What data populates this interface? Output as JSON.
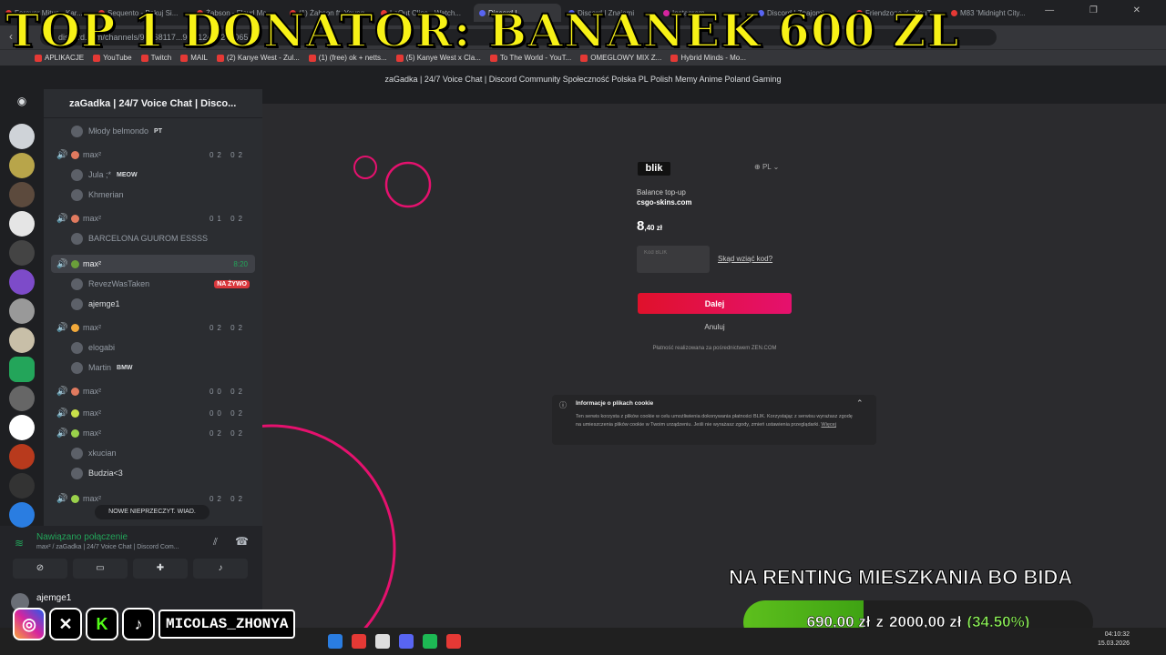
{
  "overlay": {
    "donator_banner": "TOP 1 DONATOR: BANANEK 600 ZL",
    "headline": "NA RENTING MIESZKANIA BO BIDA",
    "goal": {
      "current": "690,00 zł",
      "sep": "z",
      "target": "2000,00 zł",
      "percent": "(34.50%)",
      "fraction": 0.345
    },
    "handle": "MICOLAS_ZHONYA",
    "social_icons": [
      "instagram-icon",
      "x-icon",
      "kick-icon",
      "tiktok-icon"
    ]
  },
  "browser": {
    "tabs": [
      "Forever Mitus - Kar...",
      "Sequento - Pakuj Si...",
      "Żabson - Floyd Ma...",
      "(1) Żabson ft. Young...",
      "LeOut Clips - Watch...",
      "Discord |",
      "Discord | Znajomi",
      "Instagram",
      "Discord | Znajomi",
      "Friendzone :( - YouT...",
      "M83 'Midnight City..."
    ],
    "url": "discord.com/channels/96068117...96/112428245065...",
    "bookmarks": [
      "APLIKACJE",
      "YouTube",
      "Twitch",
      "MAIL",
      "(2) Kanye West - Zul...",
      "(1) (free) ok + netts...",
      "(5) Kanye West x Cla...",
      "To The World - YouT...",
      "OMEGLOWY MIX Z...",
      "Hybrid Minds - Mo..."
    ],
    "window_title": "zaGadka | 24/7 Voice Chat | Discord Community Społeczność Polska PL Polish Memy Anime Poland Gaming"
  },
  "discord": {
    "server_name": "zaGadka | 24/7 Voice Chat | Disco...",
    "channels": [
      {
        "type": "member",
        "name": "Młody belmondo",
        "tag": "PT"
      },
      {
        "type": "vc",
        "name": "max²",
        "count": "02 02"
      },
      {
        "type": "member",
        "name": "Jula ;*",
        "tag": "MEOW"
      },
      {
        "type": "member",
        "name": "Khmerian"
      },
      {
        "type": "vc",
        "name": "max²",
        "count": "01 02"
      },
      {
        "type": "member",
        "name": "BARCELONA GUUROM ESSSS"
      },
      {
        "type": "vc",
        "name": "max²",
        "time": "8:20",
        "active": true
      },
      {
        "type": "member",
        "name": "RevezWasTaken",
        "live": "NA ŻYWO"
      },
      {
        "type": "member",
        "name": "ajemge1",
        "bright": true
      },
      {
        "type": "vc",
        "name": "max²",
        "count": "02 02"
      },
      {
        "type": "member",
        "name": "elogabi"
      },
      {
        "type": "member",
        "name": "Martin",
        "tag": "BMW"
      },
      {
        "type": "vc",
        "name": "max²",
        "count": "00 02"
      },
      {
        "type": "vc",
        "name": "max²",
        "count": "00 02"
      },
      {
        "type": "vc",
        "name": "max²",
        "count": "02 02"
      },
      {
        "type": "member",
        "name": "xkucian"
      },
      {
        "type": "member",
        "name": "Budzia<3",
        "bright": true
      },
      {
        "type": "vc",
        "name": "max²",
        "count": "02 02"
      }
    ],
    "new_unread": "NOWE NIEPRZECZYT. WIAD.",
    "voice_status": "Nawiązano połączenie",
    "voice_channel": "max² / zaGadka | 24/7 Voice Chat | Discord Com...",
    "username": "ajemge1"
  },
  "payment": {
    "brand": "blik",
    "lang": "PL",
    "balance_label": "Balance top-up",
    "site": "csgo-skins.com",
    "amount_main": "8",
    "amount_decimals": ",40 zł",
    "code_placeholder": "Kod BLIK",
    "where_link": "Skąd wziąć kod?",
    "submit": "Dalej",
    "cancel": "Anuluj",
    "processor_note": "Płatność realizowana za pośrednictwem ZEN.COM",
    "cookie_title": "Informacje o plikach cookie",
    "cookie_text": "Ten serwis korzysta z plików cookie w celu umożliwienia dokonywania płatności BLIK. Korzystając z serwisu wyrażasz zgodę na umieszczenia plików cookie w Twoim urządzeniu. Jeśli nie wyrażasz zgody, zmień ustawienia przeglądarki.",
    "cookie_more": "Więcej"
  },
  "taskbar": {
    "time": "04:10:32",
    "date": "15.03.2026"
  },
  "colors": {
    "accent": "#e0112b",
    "discord_green": "#23a55a",
    "banner": "#f7f116",
    "progress": "#5dbf1d"
  }
}
